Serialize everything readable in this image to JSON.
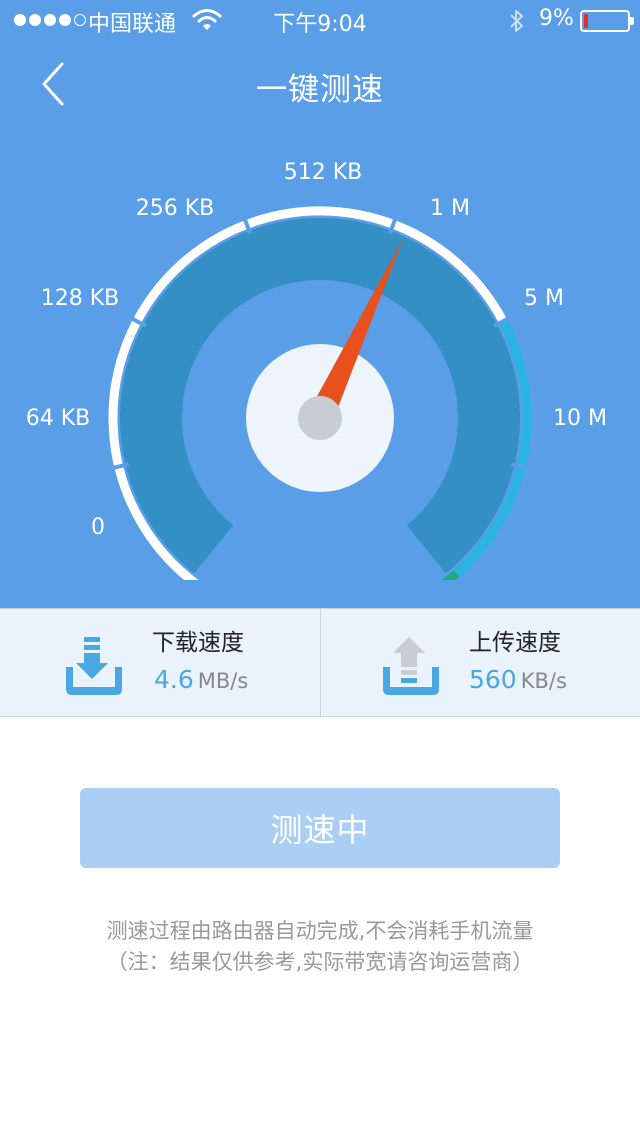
{
  "status_bar": {
    "signal_dots_filled": 4,
    "signal_dots_total": 5,
    "carrier": "中国联通",
    "wifi_icon": "wifi-icon",
    "time": "下午9:04",
    "bluetooth_icon": "bluetooth-icon",
    "battery_percent": "9%",
    "battery_level": 0.09,
    "battery_color": "#e62b2b"
  },
  "nav": {
    "back_icon": "chevron-left-icon",
    "title": "一键测速"
  },
  "gauge": {
    "scale_labels": [
      "0",
      "64 KB",
      "128 KB",
      "256 KB",
      "512 KB",
      "1 M",
      "5 M",
      "10 M"
    ],
    "needle_position": 4.1,
    "colors": {
      "track": "#ffffff",
      "band": "#3490c4",
      "band_high_1": "#29b5e0",
      "band_high_2": "#21a97f",
      "needle": "#e8501e",
      "hub": "#edf4fb",
      "hub_dot": "#c9cdd3"
    }
  },
  "download": {
    "icon": "download-icon",
    "label": "下载速度",
    "value": "4.6",
    "unit": "MB/s"
  },
  "upload": {
    "icon": "upload-icon",
    "label": "上传速度",
    "value": "560",
    "unit": "KB/s"
  },
  "test_button": {
    "label": "测速中"
  },
  "note": {
    "line1": "测速过程由路由器自动完成,不会消耗手机流量",
    "line2": "（注：结果仅供参考,实际带宽请咨询运营商）"
  }
}
